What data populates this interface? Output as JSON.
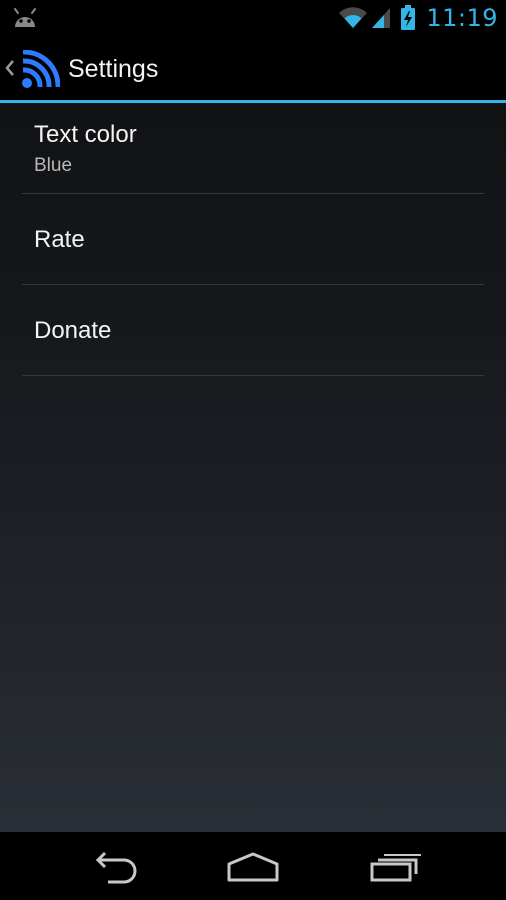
{
  "status_bar": {
    "time": "11:19",
    "accent_color": "#33b5e5",
    "icons": [
      "android-debug-icon",
      "wifi-icon",
      "cell-signal-icon",
      "battery-charging-icon"
    ]
  },
  "action_bar": {
    "title": "Settings",
    "icons": [
      "up-caret-icon",
      "rss-app-icon"
    ]
  },
  "preferences": [
    {
      "title": "Text color",
      "summary": "Blue"
    },
    {
      "title": "Rate"
    },
    {
      "title": "Donate"
    }
  ],
  "nav_bar": {
    "icons": [
      "back-icon",
      "home-icon",
      "recent-apps-icon"
    ]
  }
}
